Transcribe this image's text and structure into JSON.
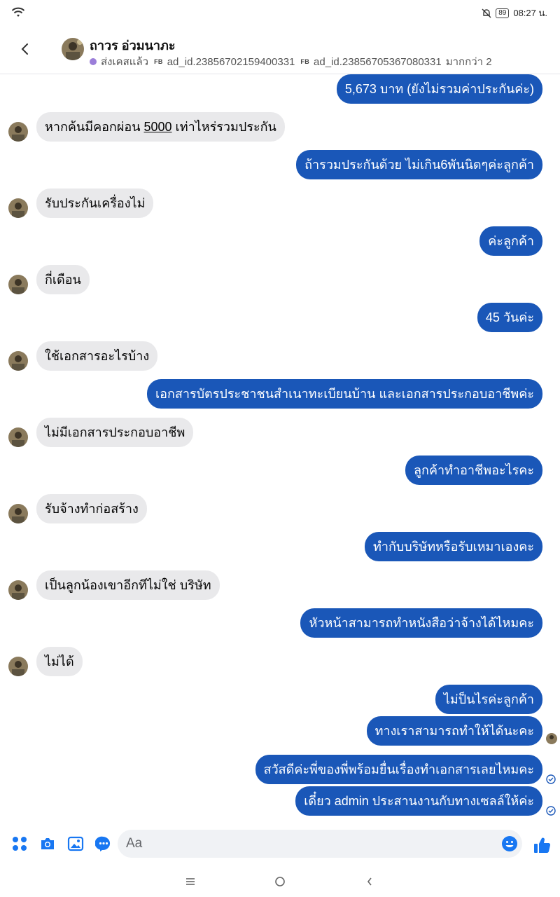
{
  "status_bar": {
    "battery": "89",
    "time": "08:27 น."
  },
  "header": {
    "contact_name": "ถาวร อ่วมนาภะ",
    "status_label": "ส่งเคสแล้ว",
    "fb_tag": "FB",
    "ad_id_1": "ad_id.23856702159400331",
    "ad_id_2": "ad_id.23856705367080331",
    "more_label": "มากกว่า 2"
  },
  "messages": [
    {
      "side": "out",
      "text": "5,673 บาท (ยังไม่รวมค่าประกันค่ะ)"
    },
    {
      "side": "in",
      "text_before": "หากค้นมีคอกผ่อน ",
      "text_underlined": "5000",
      "text_after": " เท่าไหร่รวมประกัน"
    },
    {
      "side": "out",
      "text": "ถ้ารวมประกันด้วย ไม่เกิน6พันนิดๆค่ะลูกค้า"
    },
    {
      "side": "in",
      "text": "รับประกันเครื่องไม่"
    },
    {
      "side": "out",
      "text": "ค่ะลูกค้า"
    },
    {
      "side": "in",
      "text": "กี่เดือน"
    },
    {
      "side": "out",
      "text": "45 วันค่ะ"
    },
    {
      "side": "in",
      "text": "ใช้เอกสารอะไรบ้าง"
    },
    {
      "side": "out",
      "text": "เอกสารบัตรประชาชนสำเนาทะเบียนบ้าน และเอกสารประกอบอาชีพค่ะ"
    },
    {
      "side": "in",
      "text": "ไม่มีเอกสารประกอบอาชีพ"
    },
    {
      "side": "out",
      "text": "ลูกค้าทำอาชีพอะไรคะ"
    },
    {
      "side": "in",
      "text": "รับจ้างทำก่อสร้าง"
    },
    {
      "side": "out",
      "text": "ทำกับบริษัทหรือรับเหมาเองคะ"
    },
    {
      "side": "in",
      "text": "เป็นลูกน้องเขาอีกทีไม่ใช่ บริษัท"
    },
    {
      "side": "out",
      "text": "หัวหน้าสามารถทำหนังสือว่าจ้างได้ไหมคะ"
    },
    {
      "side": "in",
      "text": "ไม่ได้"
    },
    {
      "side": "out",
      "text": "ไม่ป็นไรค่ะลูกค้า"
    },
    {
      "side": "out",
      "text": "ทางเราสามารถทำให้ได้นะคะ"
    },
    {
      "side": "out",
      "text": "สวัสดีค่ะพี่ของพี่พร้อมยื่นเรื่องทำเอกสารเลยไหมคะ"
    },
    {
      "side": "out",
      "text": "เดี๋ยว admin ประสานงานกับทางเซลล์ให้ค่ะ"
    }
  ],
  "composer": {
    "placeholder": "Aa"
  },
  "colors": {
    "outgoing_bubble": "#1a57b8",
    "incoming_bubble": "#e9e9eb",
    "accent": "#1877f2",
    "status_dot": "#9b7ed9"
  },
  "icons": [
    "wifi-icon",
    "mute-bell-icon",
    "back-arrow-icon",
    "avatar",
    "apps-grid-icon",
    "camera-icon",
    "image-icon",
    "messenger-icon",
    "emoji-icon",
    "thumbs-up-icon",
    "nav-menu-icon",
    "nav-home-icon",
    "nav-back-icon",
    "read-check-icon"
  ]
}
